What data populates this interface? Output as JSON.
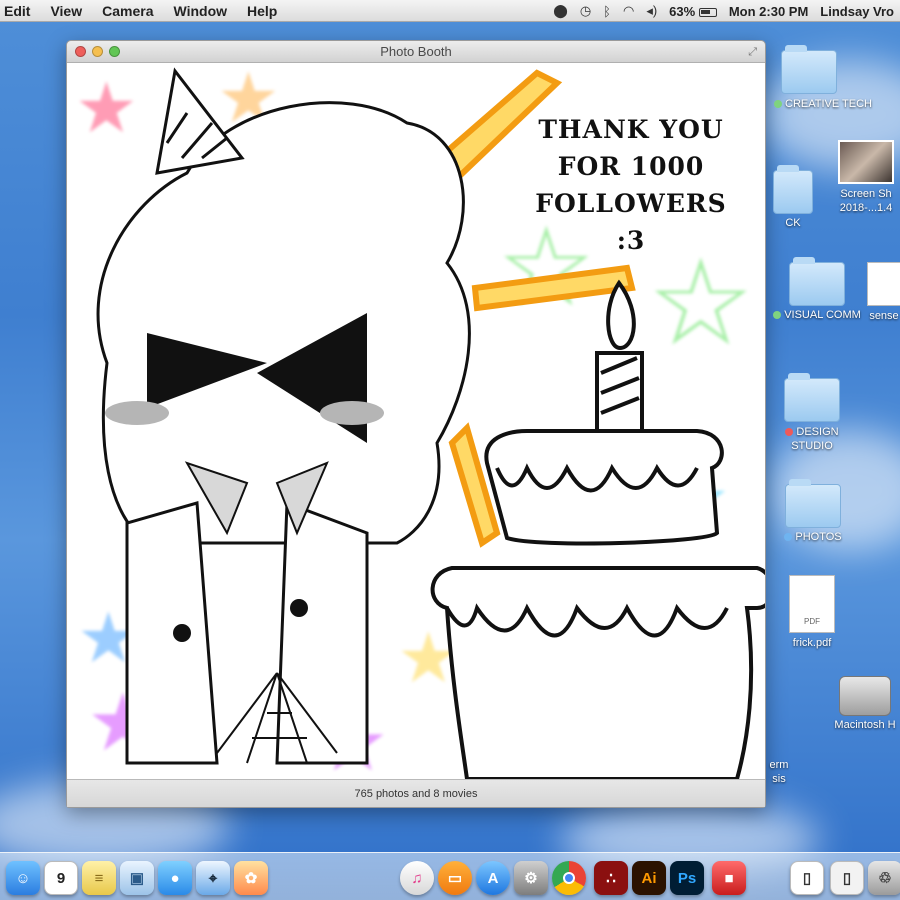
{
  "menubar": {
    "menus": [
      "Edit",
      "View",
      "Camera",
      "Window",
      "Help"
    ],
    "battery_percent": "63%",
    "clock": "Mon 2:30 PM",
    "user": "Lindsay Vro"
  },
  "window": {
    "title": "Photo Booth",
    "footer_text": "765 photos and 8 movies"
  },
  "drawing": {
    "message_lines": [
      "THANK YOU",
      "FOR 1000",
      "FOLLOWERS",
      ":3"
    ]
  },
  "desktop": {
    "items": [
      {
        "label": "CREATIVE TECH",
        "tag_color": "#7fd37f"
      },
      {
        "label": "Screen Sh 2018-...1.4"
      },
      {
        "label": "CK"
      },
      {
        "label": "VISUAL COMM",
        "tag_color": "#7fd37f"
      },
      {
        "label": "sense"
      },
      {
        "label": "DESIGN STUDIO",
        "tag_color": "#ef5a5a"
      },
      {
        "label": "PHOTOS",
        "tag_color": "#6fb4f0"
      },
      {
        "label": "frick.pdf"
      },
      {
        "label": "Macintosh H"
      },
      {
        "label": "erm sis"
      }
    ],
    "pdf_badge": "PDF"
  },
  "dock": {
    "calendar_day": "9",
    "icons": [
      "finder-icon",
      "calendar-icon",
      "notes-icon",
      "preview-icon",
      "messages-icon",
      "safari-icon",
      "photos-icon",
      "itunes-icon",
      "ibooks-icon",
      "app-store-icon",
      "system-prefs-icon",
      "chrome-icon",
      "acrobat-icon",
      "illustrator-icon",
      "photoshop-icon"
    ],
    "illustrator_label": "Ai",
    "photoshop_label": "Ps"
  }
}
